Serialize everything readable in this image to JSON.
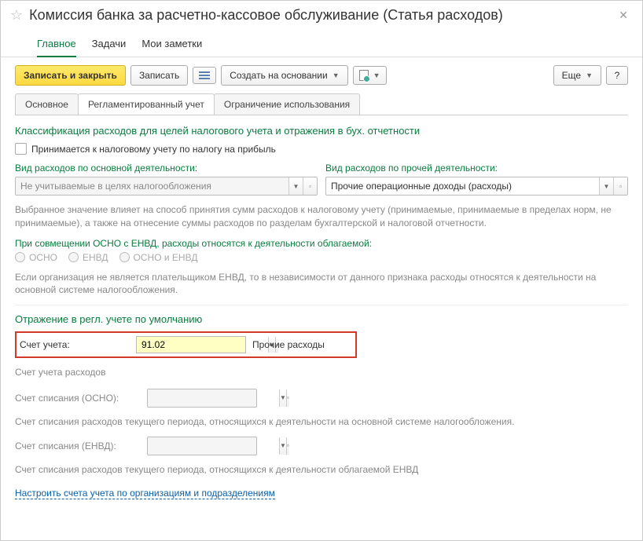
{
  "header": {
    "title": "Комиссия банка за расчетно-кассовое обслуживание (Статья расходов)"
  },
  "nav": {
    "main": "Главное",
    "tasks": "Задачи",
    "notes": "Мои заметки"
  },
  "toolbar": {
    "save_close": "Записать и закрыть",
    "save": "Записать",
    "create_based": "Создать на основании",
    "more": "Еще",
    "help": "?"
  },
  "subtabs": {
    "main": "Основное",
    "regulated": "Регламентированный учет",
    "restriction": "Ограничение использования"
  },
  "sections": {
    "classification": "Классификация расходов для целей налогового учета и отражения в бух. отчетности",
    "checkbox_label": "Принимается к налоговому учету по налогу на прибыль",
    "expense_main_label": "Вид расходов по основной деятельности:",
    "expense_main_value": "Не учитываемые в целях налогообложения",
    "expense_other_label": "Вид расходов по прочей деятельности:",
    "expense_other_value": "Прочие операционные доходы (расходы)",
    "help1": "Выбранное значение влияет на способ принятия сумм расходов к налоговому учету (принимаемые, принимаемые в пределах норм, не принимаемые), а также на отнесение суммы расходов по разделам бухгалтерской и налоговой отчетности.",
    "osno_envd_label": "При совмещении ОСНО с ЕНВД, расходы относятся к деятельности облагаемой:",
    "radio_osno": "ОСНО",
    "radio_envd": "ЕНВД",
    "radio_both": "ОСНО и ЕНВД",
    "help2": "Если организация не является плательщиком ЕНВД, то в независимости от данного признака расходы относятся к деятельности на основной системе налогообложения.",
    "default_heading": "Отражение в регл. учете по умолчанию",
    "account_label": "Счет учета:",
    "account_value": "91.02",
    "account_desc": "Прочие расходы",
    "account_expenses": "Счет учета расходов",
    "account_writeoff_osno": "Счет списания (ОСНО):",
    "help3": "Счет списания расходов текущего периода, относящихся к деятельности на основной системе налогообложения.",
    "account_writeoff_envd": "Счет списания (ЕНВД):",
    "help4": "Счет списания расходов текущего периода, относящихся к деятельности облагаемой ЕНВД",
    "link": "Настроить счета учета по организациям и подразделениям"
  }
}
